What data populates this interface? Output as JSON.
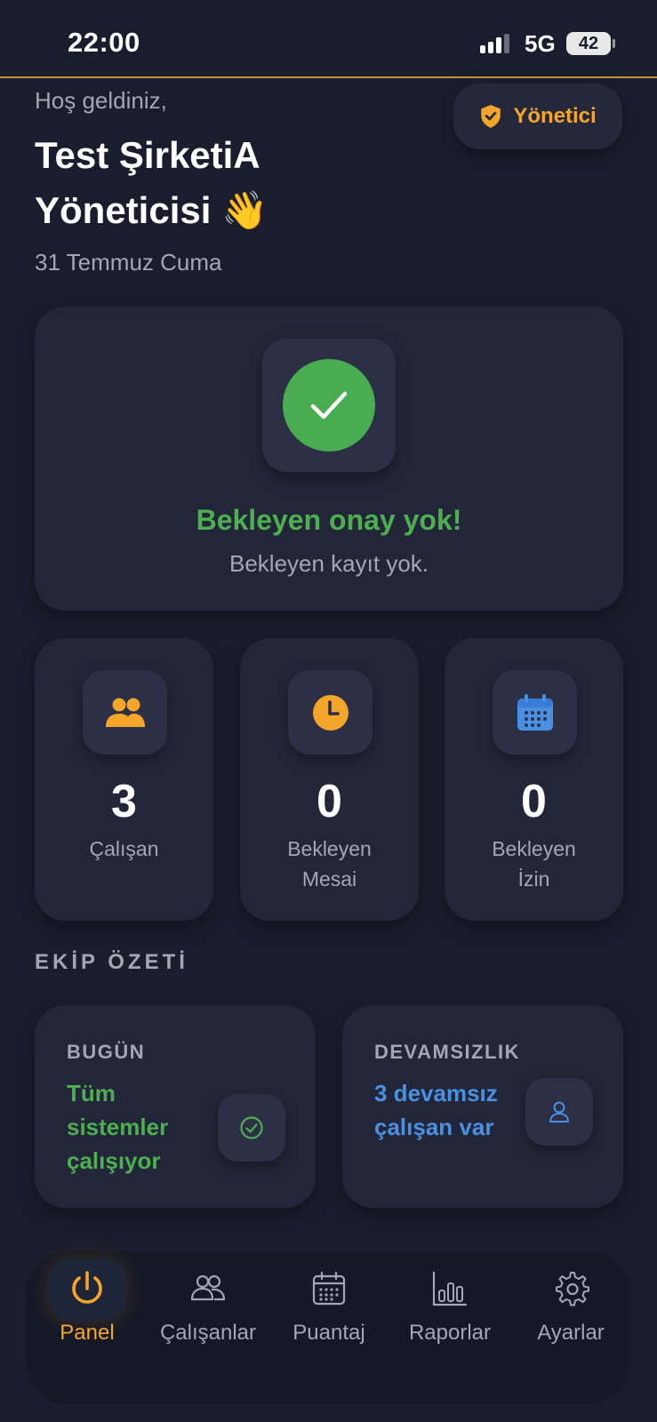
{
  "status_bar": {
    "time": "22:00",
    "network": "5G",
    "battery": "42"
  },
  "header": {
    "greeting": "Hoş geldiniz,",
    "title_line1": "Test ŞirketiA",
    "title_line2": "Yöneticisi 👋",
    "date": "31 Temmuz Cuma",
    "role_badge": "Yönetici"
  },
  "approval": {
    "title": "Bekleyen onay yok!",
    "subtitle": "Bekleyen kayıt yok."
  },
  "stats": [
    {
      "value": "3",
      "label_line1": "Çalışan",
      "label_line2": "",
      "icon": "users-icon"
    },
    {
      "value": "0",
      "label_line1": "Bekleyen",
      "label_line2": "Mesai",
      "icon": "clock-icon"
    },
    {
      "value": "0",
      "label_line1": "Bekleyen",
      "label_line2": "İzin",
      "icon": "calendar-icon"
    }
  ],
  "team_summary": {
    "section_title": "EKİP ÖZETİ",
    "today": {
      "heading": "BUGÜN",
      "text": "Tüm sistemler çalışıyor"
    },
    "absence": {
      "heading": "DEVAMSIZLIK",
      "text": "3 devamsız çalışan var"
    }
  },
  "tabbar": {
    "tabs": [
      {
        "label": "Panel",
        "icon": "power-icon",
        "active": true
      },
      {
        "label": "Çalışanlar",
        "icon": "users-icon",
        "active": false
      },
      {
        "label": "Puantaj",
        "icon": "calendar-icon",
        "active": false
      },
      {
        "label": "Raporlar",
        "icon": "bar-chart-icon",
        "active": false
      },
      {
        "label": "Ayarlar",
        "icon": "gear-icon",
        "active": false
      }
    ]
  },
  "colors": {
    "background": "#1a1d2e",
    "card": "#232638",
    "accent": "#f4a62a",
    "success": "#4caf50",
    "info": "#4a90e2",
    "muted_text": "#a3a7b5"
  }
}
